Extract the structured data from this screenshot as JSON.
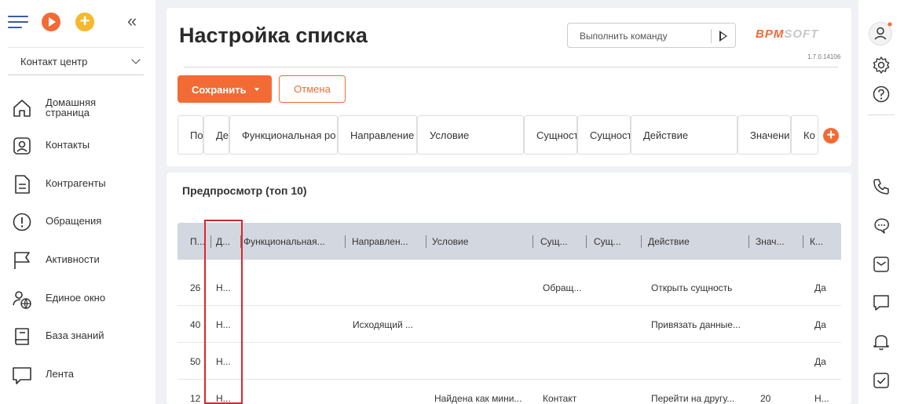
{
  "sidebar": {
    "workspace": "Контакт центр",
    "items": [
      {
        "label": "Домашняя страница",
        "icon": "home-icon"
      },
      {
        "label": "Контакты",
        "icon": "contact-icon"
      },
      {
        "label": "Контрагенты",
        "icon": "document-icon"
      },
      {
        "label": "Обращения",
        "icon": "alert-icon"
      },
      {
        "label": "Активности",
        "icon": "flag-icon"
      },
      {
        "label": "Единое окно",
        "icon": "user-globe-icon"
      },
      {
        "label": "База знаний",
        "icon": "book-icon"
      },
      {
        "label": "Лента",
        "icon": "chat-icon"
      }
    ]
  },
  "header": {
    "title": "Настройка списка",
    "command_placeholder": "Выполнить команду",
    "logo_a": "BPM",
    "logo_b": "SOFT",
    "version": "1.7.0.14106"
  },
  "toolbar": {
    "save_label": "Сохранить",
    "cancel_label": "Отмена"
  },
  "columns": [
    "По",
    "Де",
    "Функциональная ро",
    "Направление",
    "Условие",
    "Сущност",
    "Сущност",
    "Действие",
    "Значени",
    "Ко"
  ],
  "preview": {
    "title": "Предпросмотр (топ 10)",
    "headers": [
      "П...",
      "Д...",
      "Функциональная...",
      "Направлен...",
      "Условие",
      "Сущ...",
      "Сущ...",
      "Действие",
      "Знач...",
      "К..."
    ],
    "rows": [
      [
        "26",
        "Н...",
        "",
        "",
        "",
        "Обращ...",
        "",
        "Открыть сущность",
        "",
        "Да"
      ],
      [
        "40",
        "Н...",
        "",
        "Исходящий ...",
        "",
        "",
        "",
        "Привязать данные...",
        "",
        "Да"
      ],
      [
        "50",
        "Н...",
        "",
        "",
        "",
        "",
        "",
        "",
        "",
        "Да"
      ],
      [
        "12",
        "Н...",
        "",
        "",
        "Найдена как мини...",
        "Контакт",
        "",
        "Перейти на другу...",
        "20",
        "Н..."
      ]
    ]
  },
  "colors": {
    "accent": "#f26b35",
    "highlight": "#d9262c",
    "header_bg": "#d3d7df"
  }
}
